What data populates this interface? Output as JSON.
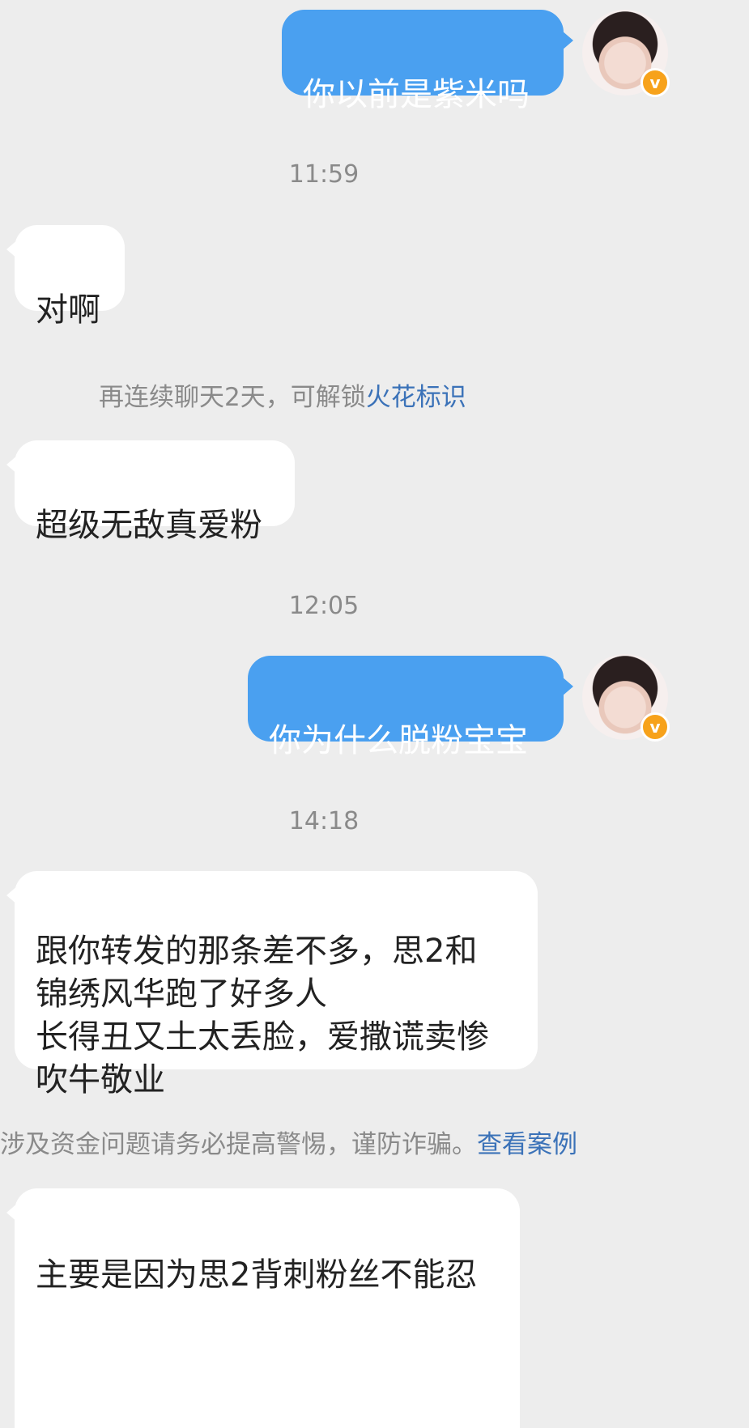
{
  "messages": [
    {
      "text": "你以前是紫米吗"
    },
    {
      "time": "11:59"
    },
    {
      "text": "对啊"
    },
    {
      "notice_text": "再连续聊天2天，可解锁",
      "notice_link": "火花标识"
    },
    {
      "text": "超级无敌真爱粉"
    },
    {
      "time": "12:05"
    },
    {
      "text": "你为什么脱粉宝宝"
    },
    {
      "time": "14:18"
    },
    {
      "text": "跟你转发的那条差不多，思2和\n锦绣风华跑了好多人\n长得丑又土太丢脸，爱撒谎卖惨\n吹牛敬业"
    },
    {
      "notice_text": "涉及资金问题请务必提高警惕，谨防诈骗。",
      "notice_link": "查看案例"
    },
    {
      "text": "主要是因为思2背刺粉丝不能忍"
    }
  ],
  "icons": {
    "avatar": "user-avatar-icon",
    "verified": "verified-badge-icon",
    "badge_letter": "v"
  },
  "colors": {
    "background": "#ededed",
    "outgoing_bubble": "#4aa0f0",
    "incoming_bubble": "#ffffff",
    "link": "#3b72b8",
    "badge": "#f7a21b"
  }
}
